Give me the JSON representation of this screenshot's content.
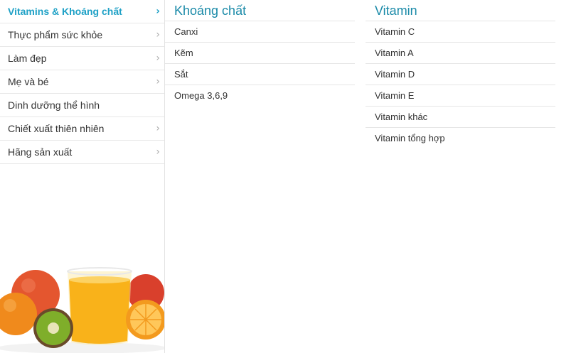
{
  "sidebar": {
    "items": [
      {
        "label": "Vitamins & Khoáng chất"
      },
      {
        "label": "Thực phẩm sức khỏe"
      },
      {
        "label": "Làm đẹp"
      },
      {
        "label": "Mẹ và bé"
      },
      {
        "label": "Dinh dưỡng thể hình"
      },
      {
        "label": "Chiết xuất thiên nhiên"
      },
      {
        "label": "Hãng sản xuất"
      }
    ],
    "chevron": "›"
  },
  "columns": [
    {
      "title": "Khoáng chất",
      "items": [
        "Canxi",
        "Kẽm",
        "Sắt",
        "Omega 3,6,9"
      ]
    },
    {
      "title": "Vitamin",
      "items": [
        "Vitamin C",
        "Vitamin A",
        "Vitamin D",
        "Vitamin E",
        "Vitamin khác",
        "Vitamin tổng hợp"
      ]
    }
  ],
  "colors": {
    "accent": "#1fa1c6",
    "title": "#1a8aa8"
  },
  "promo_image": "fruit-juice-illustration"
}
